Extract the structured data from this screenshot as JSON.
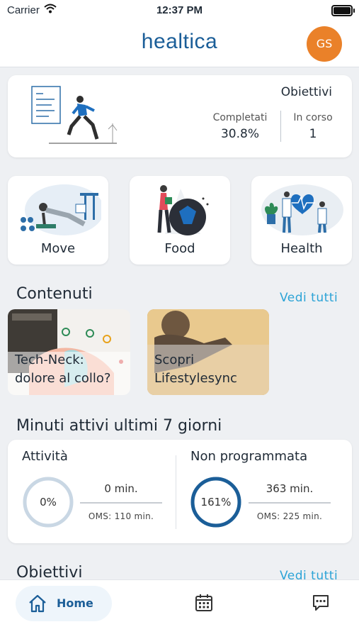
{
  "status": {
    "carrier": "Carrier",
    "time": "12:37 PM"
  },
  "header": {
    "logo": "healtica",
    "avatar_initials": "GS",
    "avatar_color": "#ea8129",
    "brand_color": "#1b5e98"
  },
  "goals_card": {
    "title": "Obiettivi",
    "completed_label": "Completati",
    "completed_value": "30.8%",
    "in_progress_label": "In corso",
    "in_progress_value": "1"
  },
  "categories": [
    {
      "label": "Move"
    },
    {
      "label": "Food"
    },
    {
      "label": "Health"
    }
  ],
  "contents": {
    "title": "Contenuti",
    "see_all": "Vedi tutti",
    "items": [
      {
        "line1": "Tech-Neck:",
        "line2": "dolore al collo?"
      },
      {
        "line1": "Scopri",
        "line2": "Lifestylesync"
      }
    ]
  },
  "active_minutes": {
    "title": "Minuti attivi ultimi 7 giorni",
    "activity": {
      "label": "Attività",
      "percent": "0%",
      "percent_value": 0,
      "minutes": "0 min.",
      "oms": "OMS: 110 min."
    },
    "unscheduled": {
      "label": "Non programmata",
      "percent": "161%",
      "percent_value": 161,
      "minutes": "363 min.",
      "oms": "OMS: 225 min."
    }
  },
  "objectives": {
    "title": "Obiettivi",
    "see_all": "Vedi tutti"
  },
  "tabbar": {
    "home_label": "Home"
  },
  "colors": {
    "accent": "#2ba3d6",
    "ring_full": "#1b5e98",
    "ring_empty": "#c9d7e4"
  }
}
